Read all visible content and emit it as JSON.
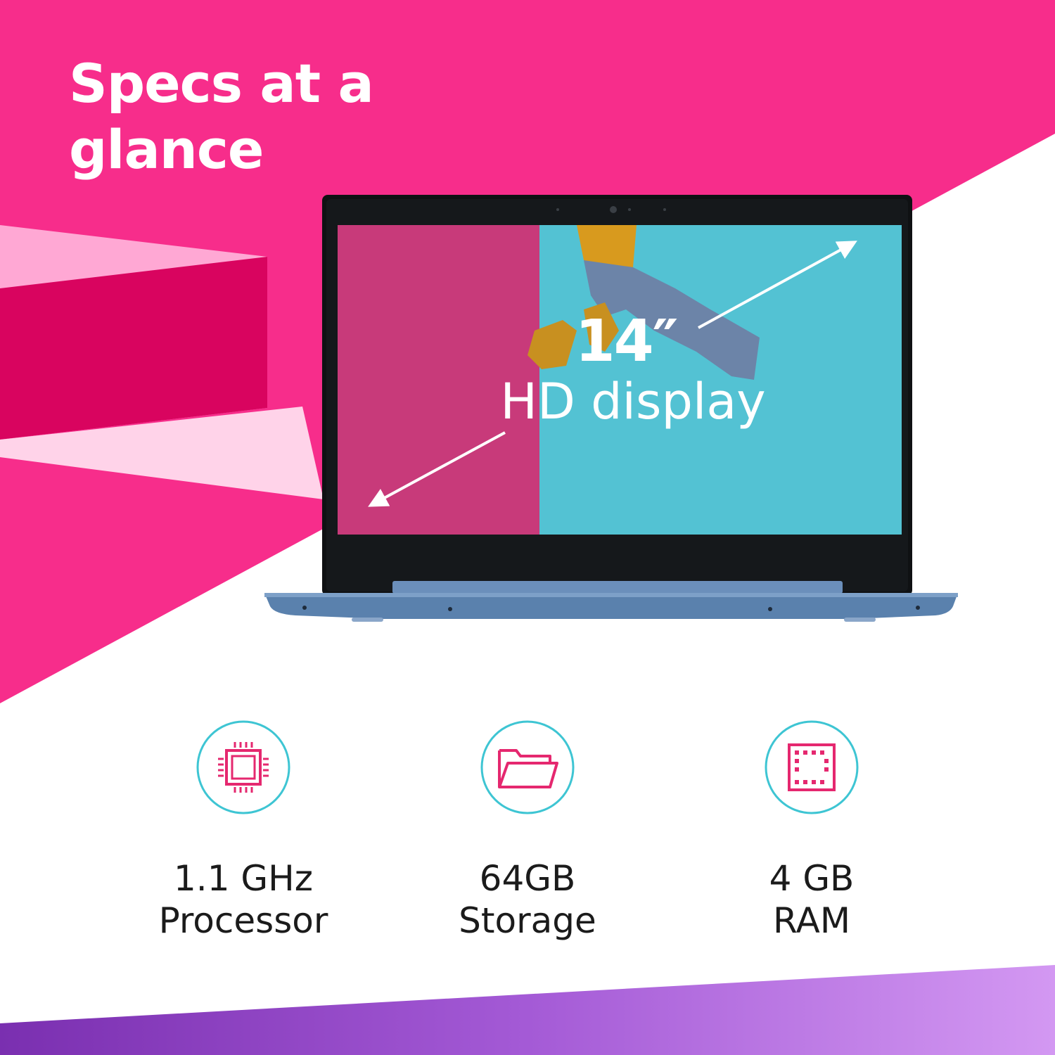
{
  "headline": {
    "line1": "Specs at a",
    "line2": "glance"
  },
  "display": {
    "size": "14″",
    "label": "HD display"
  },
  "specs": [
    {
      "value": "1.1 GHz",
      "label": "Processor",
      "icon": "processor-chip-icon"
    },
    {
      "value": "64GB",
      "label": "Storage",
      "icon": "folder-icon"
    },
    {
      "value": "4 GB",
      "label": "RAM",
      "icon": "memory-chip-icon"
    }
  ],
  "colors": {
    "brand_pink": "#f72d8b",
    "deep_pink": "#d9045f",
    "light_pink": "#ffc7e4",
    "accent_teal": "#3ec5d3",
    "icon_pink": "#e5286f",
    "laptop_blue": "#5a81ad",
    "purple": "#9a4fc7"
  }
}
